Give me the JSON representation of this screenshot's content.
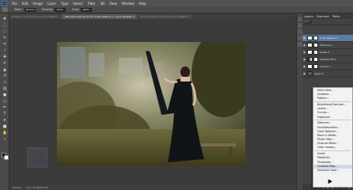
{
  "menubar": {
    "logo": "Ps",
    "items": [
      "File",
      "Edit",
      "Image",
      "Layer",
      "Type",
      "Select",
      "Filter",
      "3D",
      "View",
      "Window",
      "Help"
    ]
  },
  "options": {
    "mode_label": "Mode:",
    "mode_value": "Normal",
    "opacity_label": "Opacity:",
    "opacity_value": "100%",
    "flow_label": "Flow:",
    "flow_value": "100%"
  },
  "tabs": [
    {
      "label": "Untitled-1 @ 8.33% (Layer 1, RGB/8) ×"
    },
    {
      "label": "_IMG_4521.psd @ 16.7% (Color Balance 1, Layer Mask/8) ×"
    },
    {
      "label": "shoot_03.psd @ 25% (Curves 1, RGB/8) ×"
    }
  ],
  "status": {
    "zoom": "16.67%",
    "doc": "Doc: 47.6M/47.6M"
  },
  "layers_panel": {
    "tabs": [
      "Layers",
      "Channels",
      "Paths"
    ],
    "kind_label": "Kind",
    "layers": [
      {
        "name": "Color Balance 1",
        "selected": true
      },
      {
        "name": "Vibrance 1",
        "selected": false
      },
      {
        "name": "Levels 1",
        "selected": false
      },
      {
        "name": "Gradient Fill 1",
        "selected": false
      },
      {
        "name": "Curves 1",
        "selected": false
      },
      {
        "name": "Layer 0",
        "selected": false
      }
    ],
    "bottom_icons": [
      "link-icon",
      "fx-icon",
      "mask-icon",
      "adjustment-icon",
      "folder-icon",
      "new-layer-icon",
      "trash-icon"
    ]
  },
  "adjustment_menu": {
    "groups": [
      [
        "Solid Color...",
        "Gradient...",
        "Pattern..."
      ],
      [
        "Brightness/Contrast...",
        "Levels...",
        "Curves...",
        "Exposure..."
      ],
      [
        "Vibrance...",
        "Hue/Saturation...",
        "Color Balance...",
        "Black & White...",
        "Photo Filter...",
        "Channel Mixer...",
        "Color Lookup..."
      ],
      [
        "Invert",
        "Posterize...",
        "Threshold...",
        "Gradient Map...",
        "Selective Color..."
      ]
    ],
    "hovered": "Gradient Map..."
  },
  "colors": {
    "accent": "#5b7ba3",
    "panel": "#434343",
    "menu_bg": "#f2f2f2"
  }
}
